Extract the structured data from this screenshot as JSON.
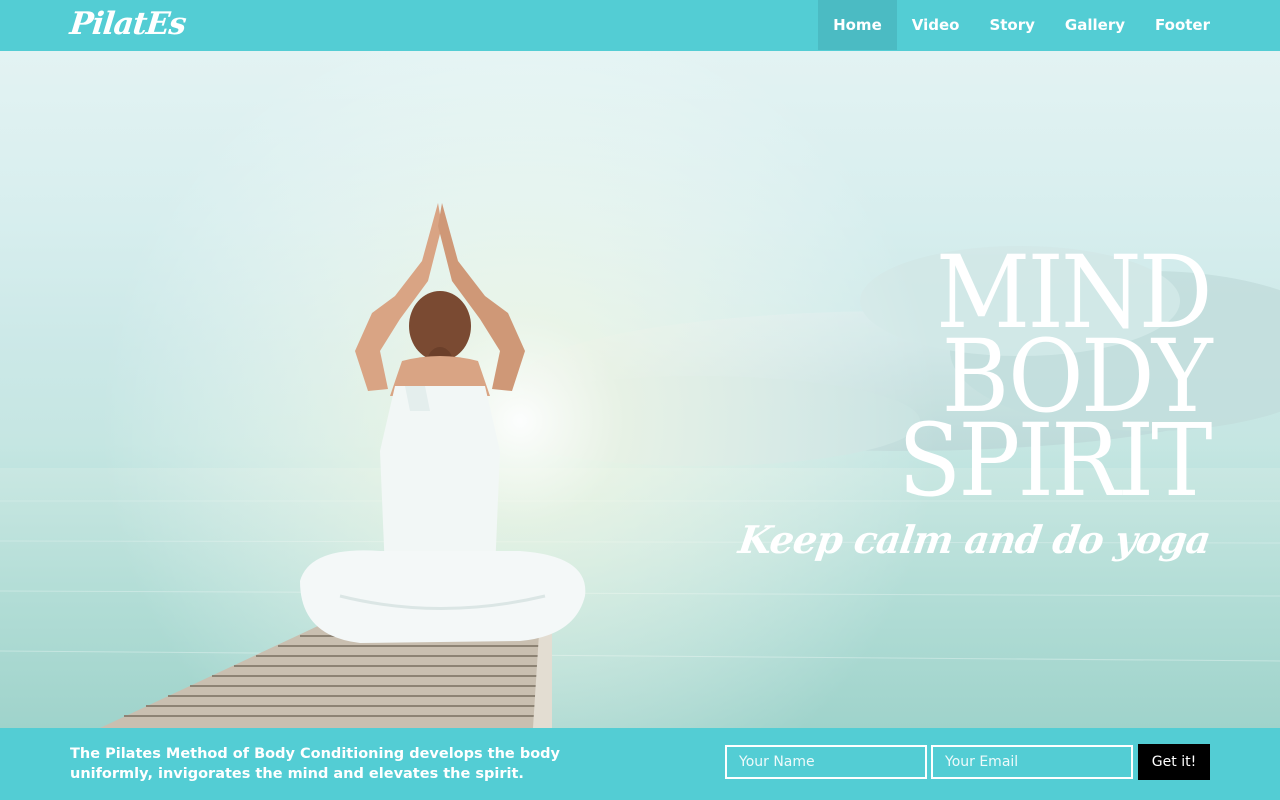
{
  "brand": {
    "logo_text": "PilatEs"
  },
  "nav": {
    "items": [
      {
        "label": "Home",
        "active": true
      },
      {
        "label": "Video",
        "active": false
      },
      {
        "label": "Story",
        "active": false
      },
      {
        "label": "Gallery",
        "active": false
      },
      {
        "label": "Footer",
        "active": false
      }
    ]
  },
  "hero": {
    "headline": [
      "MIND",
      "BODY",
      "SPIRIT"
    ],
    "tagline": "Keep calm and do yoga"
  },
  "signup": {
    "blurb": "The Pilates Method of Body Conditioning develops the body uniformly, invigorates the mind and elevates the spirit.",
    "name_placeholder": "Your Name",
    "email_placeholder": "Your Email",
    "submit_label": "Get it!"
  },
  "colors": {
    "accent": "#53cdd4",
    "active_nav": "#4bbbc3",
    "button": "#000000"
  }
}
